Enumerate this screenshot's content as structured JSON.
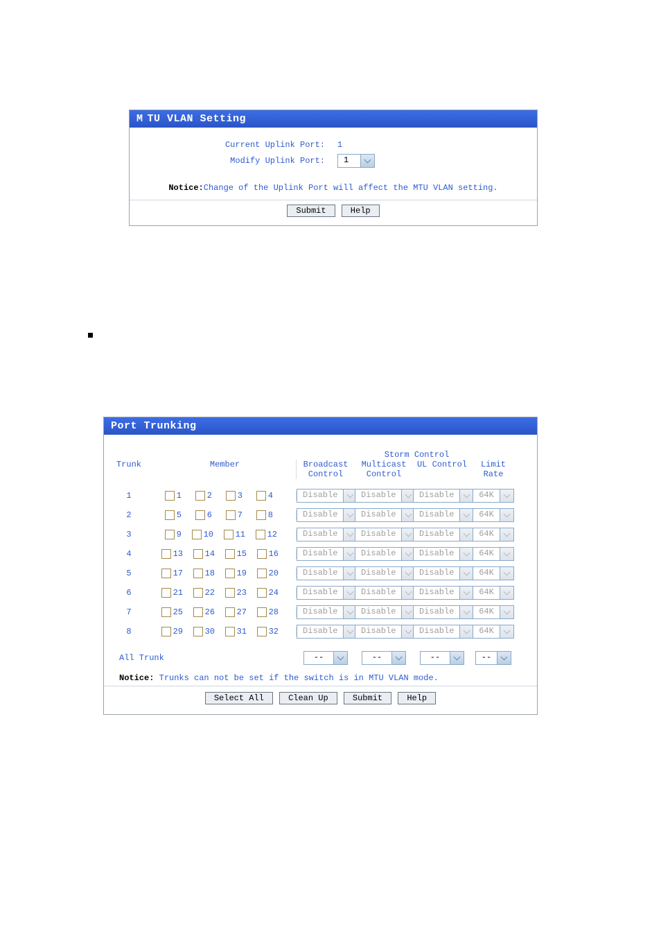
{
  "mtu": {
    "title": "TU VLAN Setting",
    "title_first_letter": "M",
    "current_label": "Current Uplink Port:",
    "current_value": "1",
    "modify_label": "Modify Uplink Port:",
    "modify_value": "1",
    "notice_label": "Notice:",
    "notice_text": "Change of the Uplink Port will affect the MTU VLAN setting.",
    "submit": "Submit",
    "help": "Help"
  },
  "pt": {
    "title": "Port Trunking",
    "trunk_header": "Trunk",
    "member_header": "Member",
    "storm_header": "Storm Control",
    "cols": {
      "broadcast": "Broadcast Control",
      "multicast": "Multicast Control",
      "ul": "UL Control",
      "limit": "Limit Rate"
    },
    "rows": [
      {
        "trunk": "1",
        "members": [
          "1",
          "2",
          "3",
          "4"
        ]
      },
      {
        "trunk": "2",
        "members": [
          "5",
          "6",
          "7",
          "8"
        ]
      },
      {
        "trunk": "3",
        "members": [
          "9",
          "10",
          "11",
          "12"
        ]
      },
      {
        "trunk": "4",
        "members": [
          "13",
          "14",
          "15",
          "16"
        ]
      },
      {
        "trunk": "5",
        "members": [
          "17",
          "18",
          "19",
          "20"
        ]
      },
      {
        "trunk": "6",
        "members": [
          "21",
          "22",
          "23",
          "24"
        ]
      },
      {
        "trunk": "7",
        "members": [
          "25",
          "26",
          "27",
          "28"
        ]
      },
      {
        "trunk": "8",
        "members": [
          "29",
          "30",
          "31",
          "32"
        ]
      }
    ],
    "select_default_disable": "Disable",
    "select_default_rate": "64K",
    "all_trunk_label": "All Trunk",
    "all_trunk_placeholder": "--",
    "notice_label": "Notice:",
    "notice_text": "Trunks can not be set if the switch is in MTU VLAN mode.",
    "buttons": {
      "select_all": "Select All",
      "clean_up": "Clean Up",
      "submit": "Submit",
      "help": "Help"
    }
  }
}
